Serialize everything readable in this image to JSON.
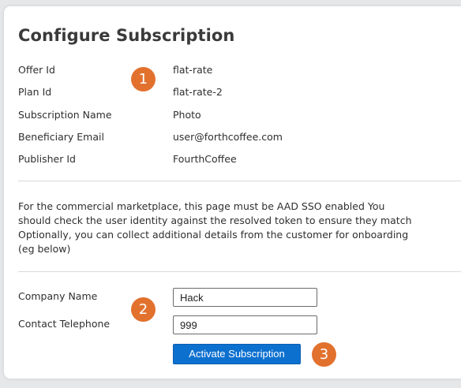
{
  "page": {
    "title": "Configure Subscription"
  },
  "details": [
    {
      "label": "Offer Id",
      "value": "flat-rate"
    },
    {
      "label": "Plan Id",
      "value": "flat-rate-2"
    },
    {
      "label": "Subscription Name",
      "value": "Photo"
    },
    {
      "label": "Beneficiary Email",
      "value": "user@forthcoffee.com"
    },
    {
      "label": "Publisher Id",
      "value": "FourthCoffee"
    }
  ],
  "note": {
    "lines": [
      "For the commercial marketplace, this page must be AAD SSO enabled You",
      "should check the user identity against the resolved token to ensure they match",
      "Optionally, you can collect additional details from the customer for onboarding",
      "(eg below)"
    ]
  },
  "form": {
    "company_label": "Company Name",
    "company_value": "Hack",
    "phone_label": "Contact Telephone",
    "phone_value": "999",
    "activate_label": "Activate Subscription"
  },
  "callouts": {
    "one": "1",
    "two": "2",
    "three": "3",
    "color": "#e2712e"
  },
  "colors": {
    "accent": "#0c70cf"
  }
}
